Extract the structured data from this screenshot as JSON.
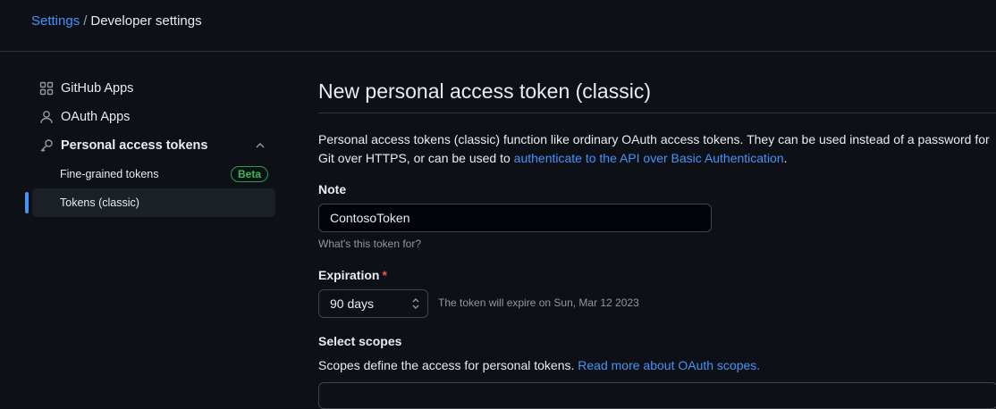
{
  "breadcrumb": {
    "root": "Settings",
    "separator": "/",
    "current": "Developer settings"
  },
  "sidebar": {
    "items": [
      {
        "label": "GitHub Apps",
        "icon": "apps-icon"
      },
      {
        "label": "OAuth Apps",
        "icon": "person-icon"
      },
      {
        "label": "Personal access tokens",
        "icon": "key-icon",
        "expanded": true
      }
    ],
    "subitems": [
      {
        "label": "Fine-grained tokens",
        "badge": "Beta"
      },
      {
        "label": "Tokens (classic)",
        "active": true
      }
    ]
  },
  "main": {
    "title": "New personal access token (classic)",
    "description": {
      "text": "Personal access tokens (classic) function like ordinary OAuth access tokens. They can be used instead of a password for Git over HTTPS, or can be used to ",
      "link": "authenticate to the API over Basic Authentication",
      "suffix": "."
    },
    "note": {
      "label": "Note",
      "value": "ContosoToken",
      "hint": "What's this token for?"
    },
    "expiration": {
      "label": "Expiration",
      "required_mark": "*",
      "selected": "90 days",
      "info": "The token will expire on Sun, Mar 12 2023"
    },
    "scopes": {
      "label": "Select scopes",
      "text": "Scopes define the access for personal tokens. ",
      "link": "Read more about OAuth scopes."
    }
  },
  "colors": {
    "background": "#0d1117",
    "link": "#4493f8",
    "border": "#30363d",
    "beta": "#3fb950",
    "required": "#f85149",
    "active_indicator": "#4493f8"
  }
}
